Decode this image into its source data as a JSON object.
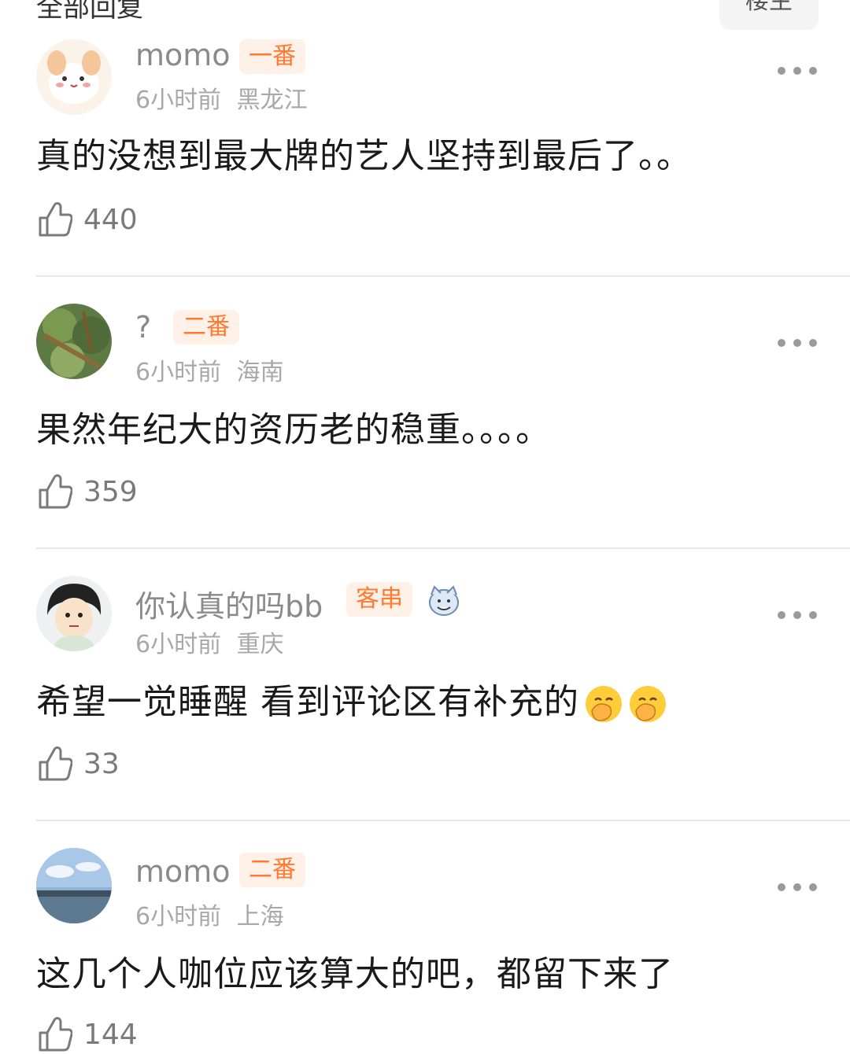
{
  "header": {
    "title": "全部回复",
    "op_tab": "楼主"
  },
  "comments": [
    {
      "username": "momo",
      "tag": "一番",
      "time": "6小时前",
      "location": "黑龙江",
      "text": "真的没想到最大牌的艺人坚持到最后了。。",
      "likes": "440"
    },
    {
      "username": "?",
      "tag": "二番",
      "time": "6小时前",
      "location": "海南",
      "text": "果然年纪大的资历老的稳重。。。。",
      "likes": "359"
    },
    {
      "username": "你认真的吗bb",
      "tag": "客串",
      "time": "6小时前",
      "location": "重庆",
      "text": "希望一觉睡醒 看到评论区有补充的",
      "likes": "33",
      "emoji": [
        "hand-over-mouth-emoji",
        "hand-over-mouth-emoji"
      ]
    },
    {
      "username": "momo",
      "tag": "二番",
      "time": "6小时前",
      "location": "上海",
      "text": "这几个人咖位应该算大的吧，都留下来了",
      "likes": "144"
    }
  ],
  "colors": {
    "tag_bg": "#fff1e8",
    "tag_text": "#ff7a30",
    "meta": "#a8a8a8"
  }
}
